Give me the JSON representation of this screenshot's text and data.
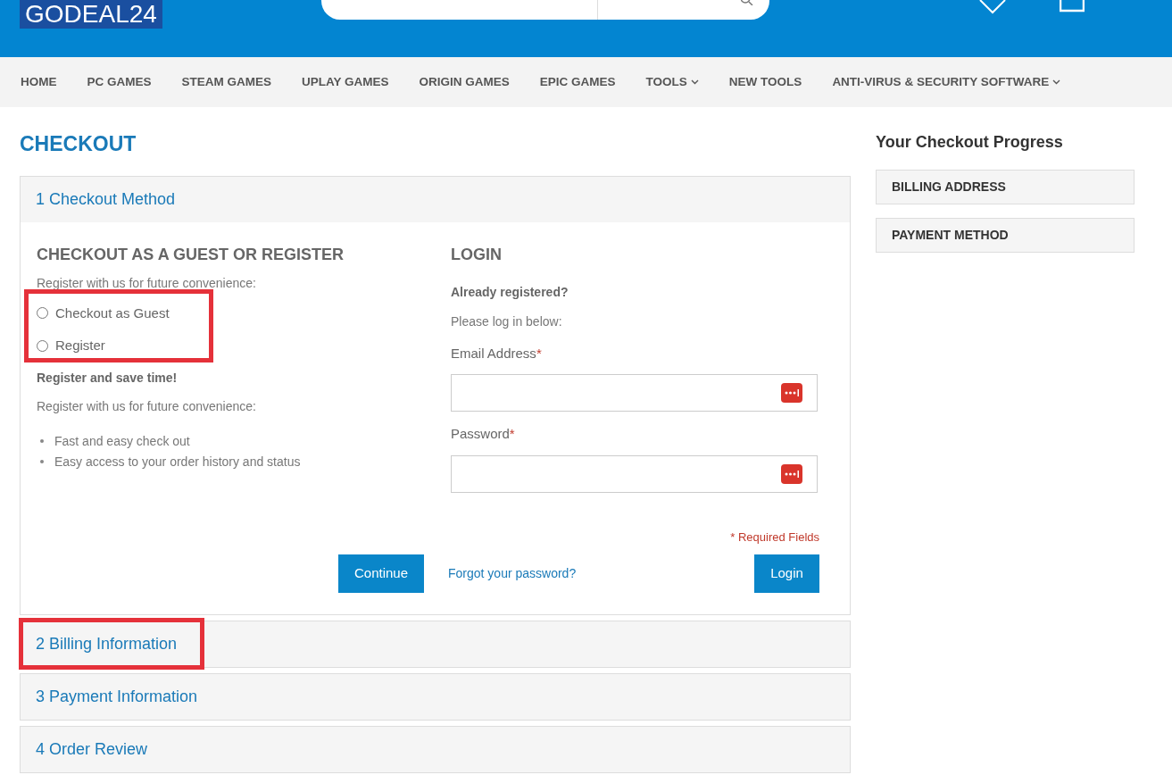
{
  "header": {
    "logo": "GODEAL24"
  },
  "nav": [
    {
      "label": "HOME",
      "dropdown": false
    },
    {
      "label": "PC GAMES",
      "dropdown": false
    },
    {
      "label": "STEAM GAMES",
      "dropdown": false
    },
    {
      "label": "UPLAY GAMES",
      "dropdown": false
    },
    {
      "label": "ORIGIN GAMES",
      "dropdown": false
    },
    {
      "label": "EPIC GAMES",
      "dropdown": false
    },
    {
      "label": "TOOLS",
      "dropdown": true
    },
    {
      "label": "NEW TOOLS",
      "dropdown": false
    },
    {
      "label": "ANTI-VIRUS & SECURITY SOFTWARE",
      "dropdown": true
    }
  ],
  "page_title": "CHECKOUT",
  "steps": [
    {
      "number": "1",
      "title": "Checkout Method",
      "expanded": true,
      "highlighted": false
    },
    {
      "number": "2",
      "title": "Billing Information",
      "expanded": false,
      "highlighted": true
    },
    {
      "number": "3",
      "title": "Payment Information",
      "expanded": false,
      "highlighted": false
    },
    {
      "number": "4",
      "title": "Order Review",
      "expanded": false,
      "highlighted": false
    }
  ],
  "guest": {
    "heading": "CHECKOUT AS A GUEST OR REGISTER",
    "intro": "Register with us for future convenience:",
    "options": [
      {
        "label": "Checkout as Guest",
        "selected": false
      },
      {
        "label": "Register",
        "selected": false
      }
    ],
    "options_highlighted": true,
    "subheading": "Register and save time!",
    "text": "Register with us for future convenience:",
    "benefits": [
      "Fast and easy check out",
      "Easy access to your order history and status"
    ],
    "button": "Continue"
  },
  "login": {
    "heading": "LOGIN",
    "subheading": "Already registered?",
    "text": "Please log in below:",
    "fields": [
      {
        "label": "Email Address",
        "required_mark": "*"
      },
      {
        "label": "Password",
        "required_mark": "*"
      }
    ],
    "required_note": "* Required Fields",
    "forgot_link": "Forgot your password?",
    "button": "Login"
  },
  "sidebar": {
    "title": "Your Checkout Progress",
    "items": [
      "BILLING ADDRESS",
      "PAYMENT METHOD"
    ]
  }
}
